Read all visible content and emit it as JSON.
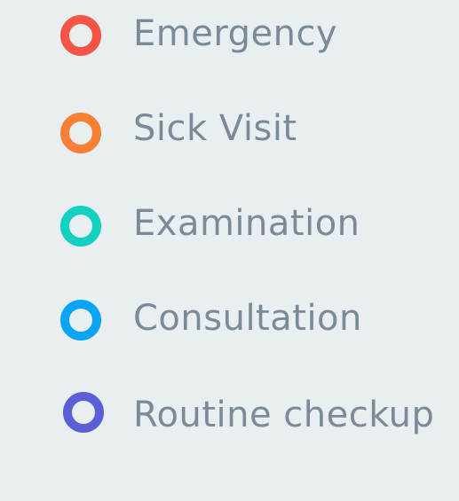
{
  "legend": {
    "items": [
      {
        "label": "Emergency",
        "color": "#f65545",
        "icon": "ring-icon"
      },
      {
        "label": "Sick Visit",
        "color": "#f88035",
        "icon": "ring-icon"
      },
      {
        "label": "Examination",
        "color": "#12d1c0",
        "icon": "ring-icon"
      },
      {
        "label": "Consultation",
        "color": "#0aa4f6",
        "icon": "ring-icon"
      },
      {
        "label": "Routine checkup",
        "color": "#5a5fd7",
        "icon": "ring-icon"
      }
    ]
  }
}
